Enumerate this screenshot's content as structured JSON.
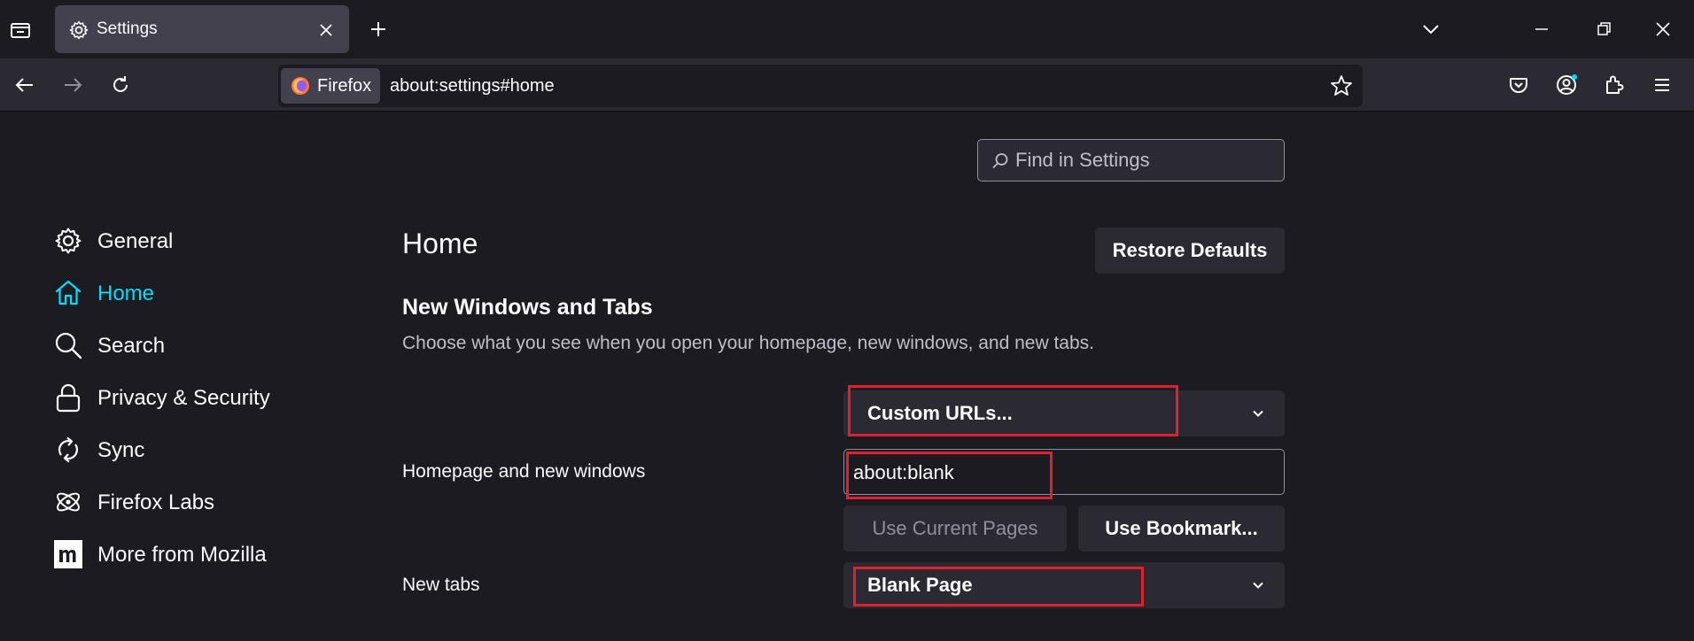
{
  "tab": {
    "title": "Settings",
    "icon": "gear-icon"
  },
  "navbar": {
    "identity_label": "Firefox",
    "url": "about:settings#home"
  },
  "search": {
    "placeholder": "Find in Settings"
  },
  "sidebar": {
    "items": [
      {
        "label": "General",
        "icon": "gear-icon",
        "active": false
      },
      {
        "label": "Home",
        "icon": "home-icon",
        "active": true
      },
      {
        "label": "Search",
        "icon": "search-icon",
        "active": false
      },
      {
        "label": "Privacy & Security",
        "icon": "lock-icon",
        "active": false
      },
      {
        "label": "Sync",
        "icon": "sync-icon",
        "active": false
      },
      {
        "label": "Firefox Labs",
        "icon": "atom-icon",
        "active": false
      },
      {
        "label": "More from Mozilla",
        "icon": "mozilla-m-icon",
        "active": false
      }
    ]
  },
  "main": {
    "page_title": "Home",
    "restore_defaults_label": "Restore Defaults",
    "section_title": "New Windows and Tabs",
    "section_description": "Choose what you see when you open your homepage, new windows, and new tabs.",
    "homepage": {
      "label": "Homepage and new windows",
      "dropdown_value": "Custom URLs...",
      "url_value": "about:blank",
      "use_current_pages_label": "Use Current Pages",
      "use_bookmark_label": "Use Bookmark..."
    },
    "new_tabs": {
      "label": "New tabs",
      "dropdown_value": "Blank Page"
    }
  },
  "colors": {
    "accent": "#00ddff",
    "highlight": "#e0202c",
    "background": "#1c1b22",
    "surface": "#2b2a33"
  }
}
